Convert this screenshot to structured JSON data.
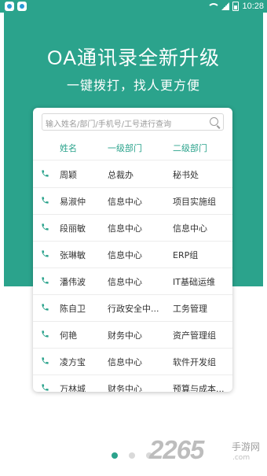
{
  "status_bar": {
    "time": "10:28"
  },
  "hero": {
    "title": "OA通讯录全新升级",
    "subtitle": "一键拨打，找人更方便"
  },
  "search": {
    "placeholder": "输入姓名/部门/手机号/工号进行查询"
  },
  "table": {
    "headers": [
      "姓名",
      "一级部门",
      "二级部门"
    ],
    "rows": [
      [
        "周颖",
        "总裁办",
        "秘书处"
      ],
      [
        "易淑仲",
        "信息中心",
        "项目实施组"
      ],
      [
        "段丽敏",
        "信息中心",
        "信息中心"
      ],
      [
        "张琳敏",
        "信息中心",
        "ERP组"
      ],
      [
        "潘伟波",
        "信息中心",
        "IT基础运维"
      ],
      [
        "陈自卫",
        "行政安全中...",
        "工务管理"
      ],
      [
        "何艳",
        "财务中心",
        "资产管理组"
      ],
      [
        "凌方宝",
        "信息中心",
        "软件开发组"
      ],
      [
        "万林城",
        "财务中心",
        "预算与成本..."
      ]
    ]
  },
  "pager": {
    "count": 3,
    "active": 0
  },
  "watermark": {
    "number": "2265",
    "text": "手游网",
    "url": ".com"
  },
  "colors": {
    "accent": "#2ba38c"
  }
}
